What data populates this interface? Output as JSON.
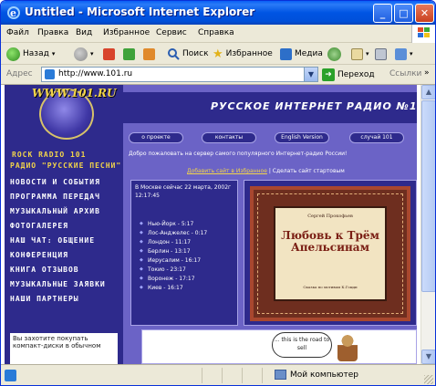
{
  "window": {
    "title": "Untitled - Microsoft Internet Explorer",
    "min_label": "_",
    "max_label": "□",
    "close_label": "✕"
  },
  "menu": {
    "items": [
      "Файл",
      "Правка",
      "Вид",
      "Избранное",
      "Сервис",
      "Справка"
    ]
  },
  "toolbar": {
    "back_label": "Назад",
    "search_label": "Поиск",
    "favorites_label": "Избранное",
    "media_label": "Медиа"
  },
  "address": {
    "label": "Адрес",
    "url": "http://www.101.ru",
    "go_label": "Переход",
    "links_label": "Ссылки"
  },
  "page": {
    "logo_text": "WWW.101.RU",
    "header_title": "РУССКОЕ ИНТЕРНЕТ РАДИО №1",
    "nav": [
      "о проекте",
      "контакты",
      "English Version",
      "случай 101"
    ],
    "side_headings": [
      "ROCK RADIO 101",
      "РАДИО \"РУССКИЕ ПЕСНИ\""
    ],
    "side_items": [
      "НОВОСТИ И СОБЫТИЯ",
      "ПРОГРАММА ПЕРЕДАЧ",
      "МУЗЫКАЛЬНЫЙ АРХИВ",
      "ФОТОГАЛЕРЕЯ",
      "НАШ ЧАТ: ОБЩЕНИЕ",
      "КОНФЕРЕНЦИЯ",
      "КНИГА ОТЗЫВОВ",
      "МУЗЫКАЛЬНЫЕ ЗАЯВКИ",
      "НАШИ ПАРТНЕРЫ"
    ],
    "side_box_text": "Вы захотите покупать компакт-диски в обычном",
    "welcome": "Добро пожаловать на сервер самого популярного Интернет-радио России!",
    "fav_link": "Добавить сайт в Избранное",
    "start_link": "Сделать сайт стартовым",
    "clock_head": "В Москве сейчас 22 марта, 2002г 12:17:45",
    "cities": [
      "Нью-Йорк - 5:17",
      "Лос-Анджелес - 0:17",
      "Лондон - 11:17",
      "Берлин - 13:17",
      "Иерусалим - 16:17",
      "Токио - 23:17",
      "Воронеж - 17:17",
      "Киев - 16:17"
    ],
    "cover_sub": "Сергей Прокофьев",
    "cover_title": "Любовь к Трём Апельсинам",
    "cover_foot": "Сказка по мотивам К.Гоцци",
    "ad_text": "... this is the road to sell"
  },
  "status": {
    "zone": "Мой компьютер"
  },
  "colors": {
    "page_bg": "#6B63C6",
    "panel_bg": "#2E2A8C",
    "accent_yellow": "#F2D44A",
    "title_blue": "#0054E3"
  }
}
